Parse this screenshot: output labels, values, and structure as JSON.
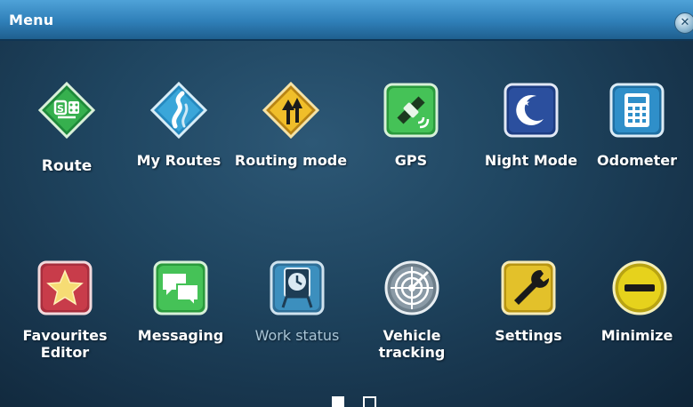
{
  "window": {
    "title": "Menu",
    "close_icon": "close-icon"
  },
  "menu": {
    "items": [
      {
        "label": "Route",
        "icon": "route-icon",
        "color": "#2ea84a"
      },
      {
        "label": "My Routes",
        "icon": "my-routes-icon",
        "color": "#3aa6d9"
      },
      {
        "label": "Routing mode",
        "icon": "routing-mode-icon",
        "color": "#e8b520"
      },
      {
        "label": "GPS",
        "icon": "gps-satellite-icon",
        "color": "#39b54a"
      },
      {
        "label": "Night Mode",
        "icon": "moon-icon",
        "color": "#2b4f9e"
      },
      {
        "label": "Odometer",
        "icon": "calculator-icon",
        "color": "#2f8fc9"
      },
      {
        "label": "Favourites Editor",
        "icon": "star-icon",
        "color": "#c83c4a"
      },
      {
        "label": "Messaging",
        "icon": "chat-bubbles-icon",
        "color": "#3cb54a"
      },
      {
        "label": "Work status",
        "icon": "work-status-clock-icon",
        "color": "#3c8fbe"
      },
      {
        "label": "Vehicle tracking",
        "icon": "radar-icon",
        "color": "#8a9aa6"
      },
      {
        "label": "Settings",
        "icon": "wrench-icon",
        "color": "#e3c12a"
      },
      {
        "label": "Minimize",
        "icon": "minus-circle-icon",
        "color": "#e6d21c"
      }
    ]
  },
  "pager": {
    "current_page": 1,
    "page_count": 2
  }
}
